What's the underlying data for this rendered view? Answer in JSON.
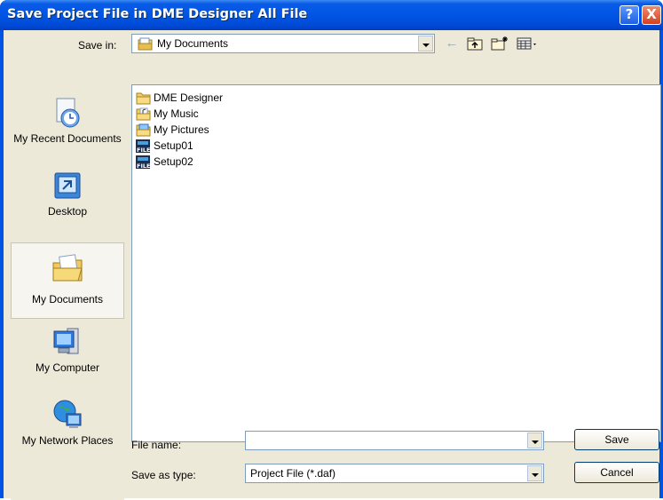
{
  "window": {
    "title": "Save Project File in DME Designer All File"
  },
  "titlebar": {
    "help": "?",
    "close": "X"
  },
  "toolbar": {
    "save_in_label": "Save in:",
    "save_in_value": "My Documents",
    "icons": [
      "back-icon",
      "up-folder-icon",
      "new-folder-icon",
      "view-menu-icon"
    ]
  },
  "places": [
    {
      "label": "My Recent Documents",
      "icon": "recent-documents-icon"
    },
    {
      "label": "Desktop",
      "icon": "desktop-icon"
    },
    {
      "label": "My Documents",
      "icon": "my-documents-icon",
      "selected": true
    },
    {
      "label": "My Computer",
      "icon": "my-computer-icon"
    },
    {
      "label": "My Network Places",
      "icon": "network-places-icon"
    }
  ],
  "files": [
    {
      "name": "DME Designer",
      "icon": "folder-icon"
    },
    {
      "name": "My Music",
      "icon": "music-folder-icon"
    },
    {
      "name": "My Pictures",
      "icon": "pictures-folder-icon"
    },
    {
      "name": "Setup01",
      "icon": "file-icon"
    },
    {
      "name": "Setup02",
      "icon": "file-icon"
    }
  ],
  "form": {
    "file_name_label": "File name:",
    "file_name_value": "",
    "save_type_label": "Save as type:",
    "save_type_value": "Project File (*.daf)"
  },
  "buttons": {
    "save": "Save",
    "cancel": "Cancel"
  },
  "colors": {
    "titlebar": "#0055e5",
    "dialog": "#ece9d8",
    "close": "#d24221",
    "border": "#7f9db9"
  }
}
